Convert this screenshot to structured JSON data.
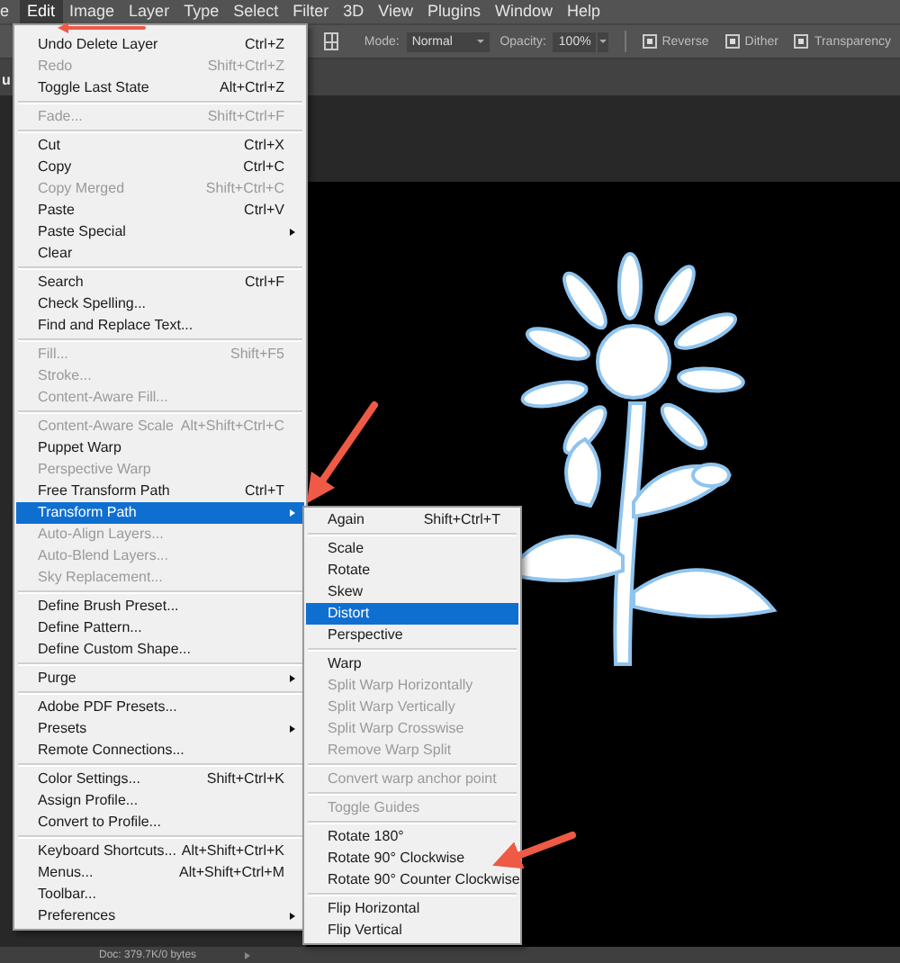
{
  "menubar": [
    {
      "label": "e",
      "selected": false
    },
    {
      "label": "Edit",
      "selected": true
    },
    {
      "label": "Image",
      "selected": false
    },
    {
      "label": "Layer",
      "selected": false
    },
    {
      "label": "Type",
      "selected": false
    },
    {
      "label": "Select",
      "selected": false
    },
    {
      "label": "Filter",
      "selected": false
    },
    {
      "label": "3D",
      "selected": false
    },
    {
      "label": "View",
      "selected": false
    },
    {
      "label": "Plugins",
      "selected": false
    },
    {
      "label": "Window",
      "selected": false
    },
    {
      "label": "Help",
      "selected": false
    }
  ],
  "options_bar": {
    "mode_label": "Mode:",
    "mode_value": "Normal",
    "opacity_label": "Opacity:",
    "opacity_value": "100%",
    "checkboxes": [
      {
        "label": "Reverse",
        "checked": true
      },
      {
        "label": "Dither",
        "checked": true
      },
      {
        "label": "Transparency",
        "checked": true
      }
    ]
  },
  "document_tab": {
    "title": "u"
  },
  "edit_menu": [
    {
      "kind": "item",
      "label": "Undo Delete Layer",
      "shortcut": "Ctrl+Z",
      "disabled": false,
      "selected": false,
      "submenu": false
    },
    {
      "kind": "item",
      "label": "Redo",
      "shortcut": "Shift+Ctrl+Z",
      "disabled": true,
      "selected": false,
      "submenu": false
    },
    {
      "kind": "item",
      "label": "Toggle Last State",
      "shortcut": "Alt+Ctrl+Z",
      "disabled": false,
      "selected": false,
      "submenu": false
    },
    {
      "kind": "separator"
    },
    {
      "kind": "item",
      "label": "Fade...",
      "shortcut": "Shift+Ctrl+F",
      "disabled": true,
      "selected": false,
      "submenu": false
    },
    {
      "kind": "separator"
    },
    {
      "kind": "item",
      "label": "Cut",
      "shortcut": "Ctrl+X",
      "disabled": false,
      "selected": false,
      "submenu": false
    },
    {
      "kind": "item",
      "label": "Copy",
      "shortcut": "Ctrl+C",
      "disabled": false,
      "selected": false,
      "submenu": false
    },
    {
      "kind": "item",
      "label": "Copy Merged",
      "shortcut": "Shift+Ctrl+C",
      "disabled": true,
      "selected": false,
      "submenu": false
    },
    {
      "kind": "item",
      "label": "Paste",
      "shortcut": "Ctrl+V",
      "disabled": false,
      "selected": false,
      "submenu": false
    },
    {
      "kind": "item",
      "label": "Paste Special",
      "disabled": false,
      "selected": false,
      "submenu": true
    },
    {
      "kind": "item",
      "label": "Clear",
      "disabled": false,
      "selected": false,
      "submenu": false
    },
    {
      "kind": "separator"
    },
    {
      "kind": "item",
      "label": "Search",
      "shortcut": "Ctrl+F",
      "disabled": false,
      "selected": false,
      "submenu": false
    },
    {
      "kind": "item",
      "label": "Check Spelling...",
      "disabled": false,
      "selected": false,
      "submenu": false
    },
    {
      "kind": "item",
      "label": "Find and Replace Text...",
      "disabled": false,
      "selected": false,
      "submenu": false
    },
    {
      "kind": "separator"
    },
    {
      "kind": "item",
      "label": "Fill...",
      "shortcut": "Shift+F5",
      "disabled": true,
      "selected": false,
      "submenu": false
    },
    {
      "kind": "item",
      "label": "Stroke...",
      "disabled": true,
      "selected": false,
      "submenu": false
    },
    {
      "kind": "item",
      "label": "Content-Aware Fill...",
      "disabled": true,
      "selected": false,
      "submenu": false
    },
    {
      "kind": "separator"
    },
    {
      "kind": "item",
      "label": "Content-Aware Scale",
      "shortcut": "Alt+Shift+Ctrl+C",
      "disabled": true,
      "selected": false,
      "submenu": false
    },
    {
      "kind": "item",
      "label": "Puppet Warp",
      "disabled": false,
      "selected": false,
      "submenu": false
    },
    {
      "kind": "item",
      "label": "Perspective Warp",
      "disabled": true,
      "selected": false,
      "submenu": false
    },
    {
      "kind": "item",
      "label": "Free Transform Path",
      "shortcut": "Ctrl+T",
      "disabled": false,
      "selected": false,
      "submenu": false
    },
    {
      "kind": "item",
      "label": "Transform Path",
      "disabled": false,
      "selected": true,
      "submenu": true
    },
    {
      "kind": "item",
      "label": "Auto-Align Layers...",
      "disabled": true,
      "selected": false,
      "submenu": false
    },
    {
      "kind": "item",
      "label": "Auto-Blend Layers...",
      "disabled": true,
      "selected": false,
      "submenu": false
    },
    {
      "kind": "item",
      "label": "Sky Replacement...",
      "disabled": true,
      "selected": false,
      "submenu": false
    },
    {
      "kind": "separator"
    },
    {
      "kind": "item",
      "label": "Define Brush Preset...",
      "disabled": false,
      "selected": false,
      "submenu": false
    },
    {
      "kind": "item",
      "label": "Define Pattern...",
      "disabled": false,
      "selected": false,
      "submenu": false
    },
    {
      "kind": "item",
      "label": "Define Custom Shape...",
      "disabled": false,
      "selected": false,
      "submenu": false
    },
    {
      "kind": "separator"
    },
    {
      "kind": "item",
      "label": "Purge",
      "disabled": false,
      "selected": false,
      "submenu": true
    },
    {
      "kind": "separator"
    },
    {
      "kind": "item",
      "label": "Adobe PDF Presets...",
      "disabled": false,
      "selected": false,
      "submenu": false
    },
    {
      "kind": "item",
      "label": "Presets",
      "disabled": false,
      "selected": false,
      "submenu": true
    },
    {
      "kind": "item",
      "label": "Remote Connections...",
      "disabled": false,
      "selected": false,
      "submenu": false
    },
    {
      "kind": "separator"
    },
    {
      "kind": "item",
      "label": "Color Settings...",
      "shortcut": "Shift+Ctrl+K",
      "disabled": false,
      "selected": false,
      "submenu": false
    },
    {
      "kind": "item",
      "label": "Assign Profile...",
      "disabled": false,
      "selected": false,
      "submenu": false
    },
    {
      "kind": "item",
      "label": "Convert to Profile...",
      "disabled": false,
      "selected": false,
      "submenu": false
    },
    {
      "kind": "separator"
    },
    {
      "kind": "item",
      "label": "Keyboard Shortcuts...",
      "shortcut": "Alt+Shift+Ctrl+K",
      "disabled": false,
      "selected": false,
      "submenu": false
    },
    {
      "kind": "item",
      "label": "Menus...",
      "shortcut": "Alt+Shift+Ctrl+M",
      "disabled": false,
      "selected": false,
      "submenu": false
    },
    {
      "kind": "item",
      "label": "Toolbar...",
      "disabled": false,
      "selected": false,
      "submenu": false
    },
    {
      "kind": "item",
      "label": "Preferences",
      "disabled": false,
      "selected": false,
      "submenu": true
    }
  ],
  "transform_submenu": [
    {
      "kind": "item",
      "label": "Again",
      "shortcut": "Shift+Ctrl+T",
      "disabled": false,
      "selected": false
    },
    {
      "kind": "separator"
    },
    {
      "kind": "item",
      "label": "Scale",
      "disabled": false,
      "selected": false
    },
    {
      "kind": "item",
      "label": "Rotate",
      "disabled": false,
      "selected": false
    },
    {
      "kind": "item",
      "label": "Skew",
      "disabled": false,
      "selected": false
    },
    {
      "kind": "item",
      "label": "Distort",
      "disabled": false,
      "selected": true
    },
    {
      "kind": "item",
      "label": "Perspective",
      "disabled": false,
      "selected": false
    },
    {
      "kind": "separator"
    },
    {
      "kind": "item",
      "label": "Warp",
      "disabled": false,
      "selected": false
    },
    {
      "kind": "item",
      "label": "Split Warp Horizontally",
      "disabled": true,
      "selected": false
    },
    {
      "kind": "item",
      "label": "Split Warp Vertically",
      "disabled": true,
      "selected": false
    },
    {
      "kind": "item",
      "label": "Split Warp Crosswise",
      "disabled": true,
      "selected": false
    },
    {
      "kind": "item",
      "label": "Remove Warp Split",
      "disabled": true,
      "selected": false
    },
    {
      "kind": "separator"
    },
    {
      "kind": "item",
      "label": "Convert warp anchor point",
      "disabled": true,
      "selected": false
    },
    {
      "kind": "separator"
    },
    {
      "kind": "item",
      "label": "Toggle Guides",
      "disabled": true,
      "selected": false
    },
    {
      "kind": "separator"
    },
    {
      "kind": "item",
      "label": "Rotate 180°",
      "disabled": false,
      "selected": false
    },
    {
      "kind": "item",
      "label": "Rotate 90° Clockwise",
      "disabled": false,
      "selected": false
    },
    {
      "kind": "item",
      "label": "Rotate 90° Counter Clockwise",
      "disabled": false,
      "selected": false
    },
    {
      "kind": "separator"
    },
    {
      "kind": "item",
      "label": "Flip Horizontal",
      "disabled": false,
      "selected": false
    },
    {
      "kind": "item",
      "label": "Flip Vertical",
      "disabled": false,
      "selected": false
    }
  ],
  "status_bar": {
    "doc_info": "Doc: 379.7K/0 bytes"
  }
}
